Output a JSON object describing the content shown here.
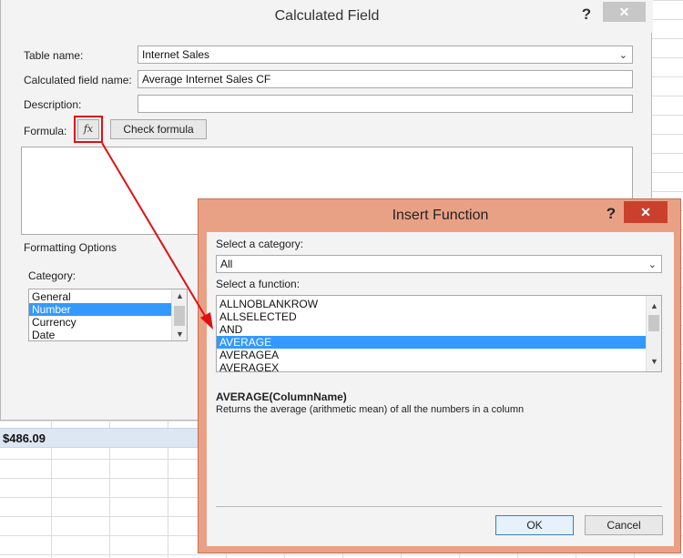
{
  "sheet": {
    "highlighted_value": "$486.09"
  },
  "calculated_field": {
    "title": "Calculated Field",
    "help_label": "?",
    "close_label": "✕",
    "table_name_label": "Table name:",
    "table_name_value": "Internet Sales",
    "field_name_label": "Calculated field name:",
    "field_name_value": "Average Internet Sales CF",
    "description_label": "Description:",
    "description_value": "",
    "formula_label": "Formula:",
    "fx_label": "fx",
    "check_formula_label": "Check formula",
    "formula_value": "",
    "formatting_options_label": "Formatting Options",
    "category_label": "Category:",
    "categories": [
      "General",
      "Number",
      "Currency",
      "Date"
    ],
    "selected_category": "Number"
  },
  "insert_function": {
    "title": "Insert Function",
    "help_label": "?",
    "close_label": "✕",
    "select_category_label": "Select a category:",
    "category_value": "All",
    "select_function_label": "Select a function:",
    "functions": [
      "ALLNOBLANKROW",
      "ALLSELECTED",
      "AND",
      "AVERAGE",
      "AVERAGEA",
      "AVERAGEX"
    ],
    "selected_function": "AVERAGE",
    "signature": "AVERAGE(ColumnName)",
    "description": "Returns the average (arithmetic mean) of all the numbers in a column",
    "ok_label": "OK",
    "cancel_label": "Cancel"
  },
  "colors": {
    "annotation_red": "#e01010",
    "selection_blue": "#3399ff",
    "insert_function_chrome": "#e9a186",
    "close_button_red": "#c9412d"
  },
  "icons": {
    "scroll_up": "scroll-up-icon",
    "scroll_down": "scroll-down-icon",
    "dropdown": "chevron-down-icon"
  }
}
